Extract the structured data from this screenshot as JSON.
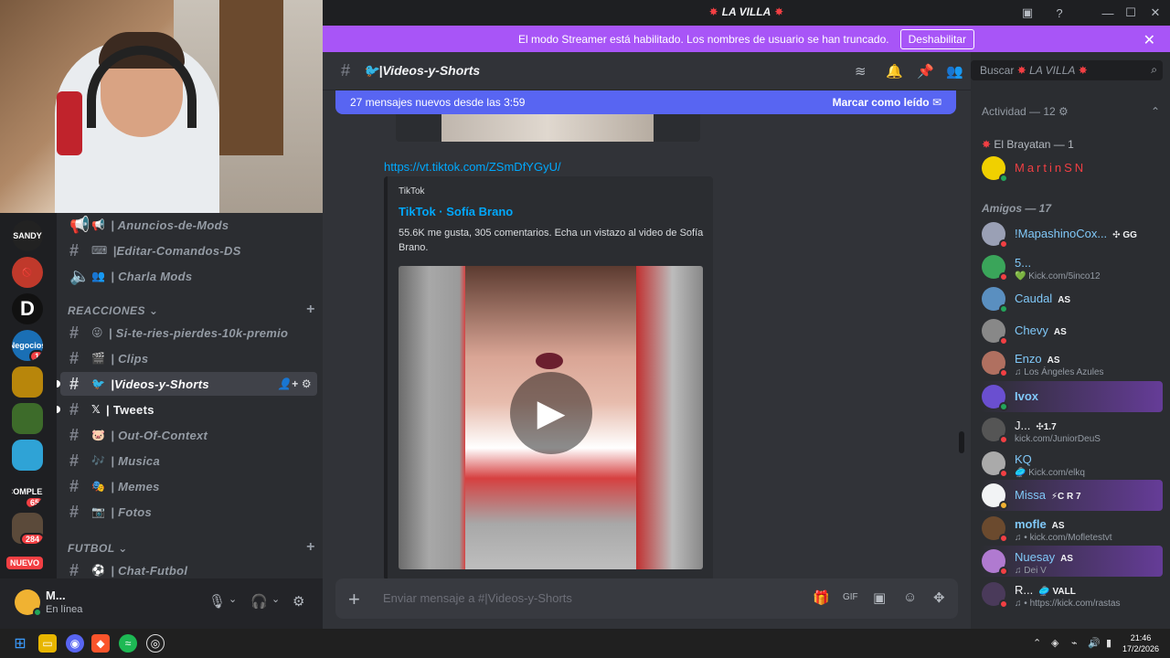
{
  "window": {
    "server_title": "LA VILLA"
  },
  "banner": {
    "text": "El modo Streamer está habilitado. Los nombres de usuario se han truncado.",
    "button": "Deshabilitar"
  },
  "rail": {
    "servers": [
      {
        "label": "SANDY",
        "color": "#222222",
        "badge": ""
      },
      {
        "label": "",
        "color": "#c0392b",
        "badge": ""
      },
      {
        "label": "D",
        "color": "#111111",
        "badge": ""
      },
      {
        "label": "Negocios",
        "color": "#1a6fb5",
        "badge": "1"
      },
      {
        "label": "",
        "color": "#b8860b",
        "badge": ""
      },
      {
        "label": "",
        "color": "#3d6b2a",
        "badge": ""
      },
      {
        "label": "",
        "color": "#2fa3d6",
        "badge": ""
      },
      {
        "label": "COMPLEX",
        "color": "#1e1f22",
        "badge": "65"
      },
      {
        "label": "",
        "color": "#5b4a3a",
        "badge": "284"
      }
    ],
    "new_label": "NUEVO"
  },
  "channels": {
    "items": [
      {
        "emoji": "📢",
        "label": "| Anuncios-de-Mods"
      },
      {
        "emoji": "⌨",
        "label": "|Editar-Comandos-DS"
      },
      {
        "emoji": "👥",
        "label": "| Charla Mods"
      }
    ],
    "cat1": "REACCIONES",
    "items2": [
      {
        "emoji": "😜",
        "label": "| Si-te-ries-pierdes-10k-premio"
      },
      {
        "emoji": "🎬",
        "label": "| Clips"
      },
      {
        "emoji": "",
        "label": "|Videos-y-Shorts"
      },
      {
        "emoji": "𝕏",
        "label": "| Tweets"
      },
      {
        "emoji": "🐷",
        "label": "| Out-Of-Context"
      },
      {
        "emoji": "🎶",
        "label": "| Musica"
      },
      {
        "emoji": "🎭",
        "label": "| Memes"
      },
      {
        "emoji": "📷",
        "label": "| Fotos"
      }
    ],
    "cat2": "FUTBOL",
    "items3": [
      {
        "emoji": "⚽",
        "label": "| Chat-Futbol"
      }
    ]
  },
  "user": {
    "name": "M...",
    "status": "En línea"
  },
  "chat": {
    "channel_name": "|Videos-y-Shorts",
    "new_messages": "27 mensajes nuevos desde las 3:59",
    "mark_read": "Marcar como leído",
    "link": "https://vt.tiktok.com/ZSmDfYGyU/",
    "embed": {
      "provider": "TikTok",
      "title": "TikTok · Sofía Brano",
      "description": "55.6K me gusta, 305 comentarios. Echa un vistazo al video de Sofía Brano."
    },
    "placeholder": "Enviar mensaje a #|Videos-y-Shorts"
  },
  "members": {
    "search_placeholder": "Buscar",
    "search_server": "LA VILLA",
    "activity": "Actividad — 12",
    "group1": "El Brayatan — 1",
    "group2": "Amigos — 17",
    "list": [
      {
        "name": "MartinSN",
        "tag": "",
        "sub": "",
        "color": "#f23f43",
        "av": "#f0d000",
        "st": "#23a55a"
      },
      {
        "name": "!MapashinoCox...",
        "tag": "GG",
        "sub": "",
        "color": "#80c8f8",
        "av": "#9aa0b5",
        "st": "#f23f43"
      },
      {
        "name": "5...",
        "tag": "",
        "sub": "Kick.com/5inco12",
        "color": "#80c8f8",
        "av": "#3aa55a",
        "st": "#f23f43"
      },
      {
        "name": "Caudal",
        "tag": "AS",
        "sub": "",
        "color": "#80c8f8",
        "av": "#5a8fc0",
        "st": "#23a55a"
      },
      {
        "name": "Chevy",
        "tag": "AS",
        "sub": "",
        "color": "#80c8f8",
        "av": "#888888",
        "st": "#f23f43"
      },
      {
        "name": "Enzo",
        "tag": "AS",
        "sub": "Los Ángeles Azules",
        "color": "#80c8f8",
        "av": "#b07060",
        "st": "#f23f43"
      },
      {
        "name": "Ivox",
        "tag": "",
        "sub": "",
        "color": "#80c8f8",
        "av": "#6a4fd0",
        "st": "#23a55a"
      },
      {
        "name": "J...",
        "tag": "1.7",
        "sub": "kick.com/JuniorDeuS",
        "color": "#f2f3f5",
        "av": "#555555",
        "st": "#f23f43"
      },
      {
        "name": "KQ",
        "tag": "",
        "sub": "Kick.com/elkq",
        "color": "#80c8f8",
        "av": "#aaaaaa",
        "st": "#f23f43"
      },
      {
        "name": "Missa",
        "tag": "C R 7",
        "sub": "",
        "color": "#80c8f8",
        "av": "#f2f3f5",
        "st": "#f0b232"
      },
      {
        "name": "mofle",
        "tag": "AS",
        "sub": "kick.com/Mofletestvt",
        "color": "#80c8f8",
        "av": "#6b4a2e",
        "st": "#f23f43"
      },
      {
        "name": "Nuesay",
        "tag": "AS",
        "sub": "Dei V",
        "color": "#80c8f8",
        "av": "#b07ad0",
        "st": "#f23f43"
      },
      {
        "name": "R...",
        "tag": "VALL",
        "sub": "https://kick.com/rastas",
        "color": "#f2f3f5",
        "av": "#4a3a5a",
        "st": "#f23f43"
      }
    ]
  },
  "taskbar": {
    "time": "21:46",
    "date": "17/2/2026"
  }
}
